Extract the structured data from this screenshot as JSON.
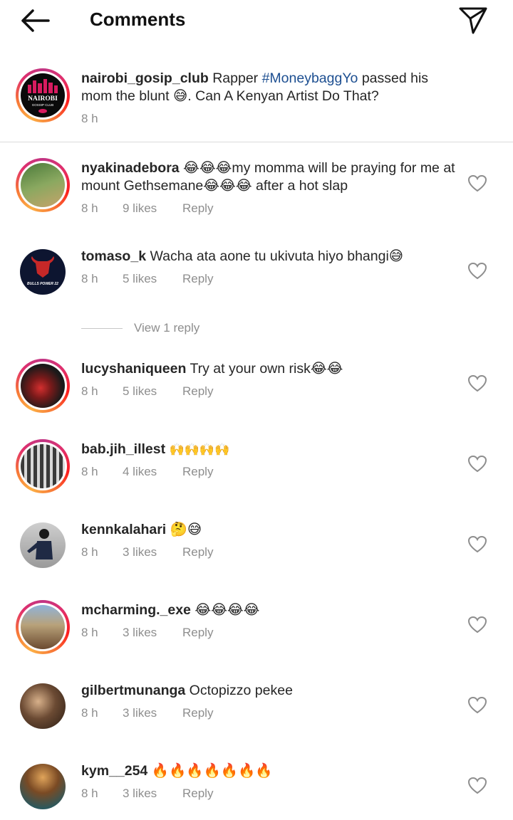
{
  "header": {
    "title": "Comments",
    "back_icon": "arrow-left-icon",
    "send_icon": "paper-plane-icon"
  },
  "caption": {
    "username": "nairobi_gosip_club",
    "text_before": " Rapper ",
    "hashtag": "#MoneybaggYo",
    "text_after": " passed his mom the blunt 😅. Can A Kenyan Artist Do That?",
    "time": "8 h",
    "avatar_text_main": "NAIROBI",
    "avatar_text_sub": "GOSSIP CLUB"
  },
  "comments": [
    {
      "username": "nyakinadebora",
      "text": " 😂😂😂my momma will be praying for me at mount Gethsemane😂😂😂 after a hot slap",
      "time": "8 h",
      "likes": "9 likes",
      "reply": "Reply"
    },
    {
      "username": "tomaso_k",
      "text": " Wacha ata  aone tu ukivuta hiyo bhangi😅",
      "time": "8 h",
      "likes": "5 likes",
      "reply": "Reply",
      "avatar_text": "BULLS POWER 22"
    },
    {
      "username": "lucyshaniqueen",
      "text": " Try at your own risk😂😂",
      "time": "8 h",
      "likes": "5 likes",
      "reply": "Reply"
    },
    {
      "username": "bab.jih_illest",
      "text": " 🙌🙌🙌🙌",
      "time": "8 h",
      "likes": "4 likes",
      "reply": "Reply"
    },
    {
      "username": "kennkalahari",
      "text": " 🤔😅",
      "time": "8 h",
      "likes": "3 likes",
      "reply": "Reply"
    },
    {
      "username": "mcharming._exe",
      "text": " 😂😂😂😂",
      "time": "8 h",
      "likes": "3 likes",
      "reply": "Reply"
    },
    {
      "username": "gilbertmunanga",
      "text": " Octopizzo pekee",
      "time": "8 h",
      "likes": "3 likes",
      "reply": "Reply"
    },
    {
      "username": "kym__254",
      "text": " 🔥🔥🔥🔥🔥🔥🔥",
      "time": "8 h",
      "likes": "3 likes",
      "reply": "Reply"
    }
  ],
  "view_replies": "View 1 reply",
  "colors": {
    "hashtag": "#1d4f91",
    "meta": "#8e8e8e",
    "ring": "#e1306c"
  }
}
